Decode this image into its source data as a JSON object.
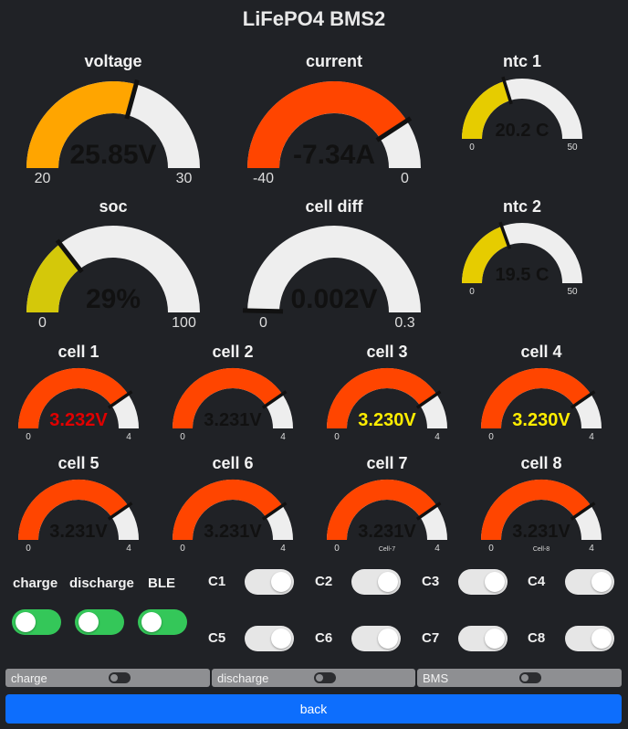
{
  "title": "LiFePO4 BMS2",
  "colors": {
    "track": "#eeeeee",
    "needle": "#111111",
    "scale": "#dddddd"
  },
  "gauges": [
    {
      "id": "voltage",
      "label": "voltage",
      "value": 25.85,
      "display": "25.85V",
      "min": 20,
      "max": 30,
      "min_label": "20",
      "max_label": "30",
      "color": "#ffa500",
      "value_color": "#111111",
      "sub": ""
    },
    {
      "id": "current",
      "label": "current",
      "value": -7.34,
      "display": "-7.34A",
      "min": -40,
      "max": 0,
      "min_label": "-40",
      "max_label": "0",
      "color": "#ff4500",
      "value_color": "#111111",
      "sub": ""
    },
    {
      "id": "ntc1",
      "label": "ntc 1",
      "value": 20.2,
      "display": "20.2 C",
      "min": 0,
      "max": 50,
      "min_label": "0",
      "max_label": "50",
      "color": "#e6cc00",
      "value_color": "#111111",
      "sub": ""
    },
    {
      "id": "soc",
      "label": "soc",
      "value": 29,
      "display": "29%",
      "min": 0,
      "max": 100,
      "min_label": "0",
      "max_label": "100",
      "color": "#d4c80a",
      "value_color": "#111111",
      "sub": ""
    },
    {
      "id": "celldiff",
      "label": "cell diff",
      "value": 0.002,
      "display": "0.002V",
      "min": 0,
      "max": 0.3,
      "min_label": "0",
      "max_label": "0.3",
      "color": "#d4c80a",
      "value_color": "#111111",
      "sub": ""
    },
    {
      "id": "ntc2",
      "label": "ntc 2",
      "value": 19.5,
      "display": "19.5 C",
      "min": 0,
      "max": 50,
      "min_label": "0",
      "max_label": "50",
      "color": "#e6cc00",
      "value_color": "#111111",
      "sub": ""
    },
    {
      "id": "cell1",
      "label": "cell 1",
      "value": 3.232,
      "display": "3.232V",
      "min": 0,
      "max": 4,
      "min_label": "0",
      "max_label": "4",
      "color": "#ff4500",
      "value_color": "#e00000",
      "sub": ""
    },
    {
      "id": "cell2",
      "label": "cell 2",
      "value": 3.231,
      "display": "3.231V",
      "min": 0,
      "max": 4,
      "min_label": "0",
      "max_label": "4",
      "color": "#ff4500",
      "value_color": "#111111",
      "sub": ""
    },
    {
      "id": "cell3",
      "label": "cell 3",
      "value": 3.23,
      "display": "3.230V",
      "min": 0,
      "max": 4,
      "min_label": "0",
      "max_label": "4",
      "color": "#ff4500",
      "value_color": "#ffee00",
      "sub": ""
    },
    {
      "id": "cell4",
      "label": "cell 4",
      "value": 3.23,
      "display": "3.230V",
      "min": 0,
      "max": 4,
      "min_label": "0",
      "max_label": "4",
      "color": "#ff4500",
      "value_color": "#ffee00",
      "sub": ""
    },
    {
      "id": "cell5",
      "label": "cell 5",
      "value": 3.231,
      "display": "3.231V",
      "min": 0,
      "max": 4,
      "min_label": "0",
      "max_label": "4",
      "color": "#ff4500",
      "value_color": "#111111",
      "sub": ""
    },
    {
      "id": "cell6",
      "label": "cell 6",
      "value": 3.231,
      "display": "3.231V",
      "min": 0,
      "max": 4,
      "min_label": "0",
      "max_label": "4",
      "color": "#ff4500",
      "value_color": "#111111",
      "sub": ""
    },
    {
      "id": "cell7",
      "label": "cell 7",
      "value": 3.231,
      "display": "3.231V",
      "min": 0,
      "max": 4,
      "min_label": "0",
      "max_label": "4",
      "color": "#ff4500",
      "value_color": "#111111",
      "sub": "Cell-7"
    },
    {
      "id": "cell8",
      "label": "cell 8",
      "value": 3.231,
      "display": "3.231V",
      "min": 0,
      "max": 4,
      "min_label": "0",
      "max_label": "4",
      "color": "#ff4500",
      "value_color": "#111111",
      "sub": "Cell-8"
    }
  ],
  "toggles": {
    "charge": {
      "label": "charge",
      "on": true
    },
    "discharge": {
      "label": "discharge",
      "on": true
    },
    "ble": {
      "label": "BLE",
      "on": true
    }
  },
  "balance": [
    {
      "label": "C1",
      "on": false
    },
    {
      "label": "C2",
      "on": false
    },
    {
      "label": "C3",
      "on": false
    },
    {
      "label": "C4",
      "on": false
    },
    {
      "label": "C5",
      "on": false
    },
    {
      "label": "C6",
      "on": false
    },
    {
      "label": "C7",
      "on": false
    },
    {
      "label": "C8",
      "on": false
    }
  ],
  "status_bars": [
    {
      "label": "charge"
    },
    {
      "label": "discharge"
    },
    {
      "label": "BMS"
    }
  ],
  "back_label": "back"
}
